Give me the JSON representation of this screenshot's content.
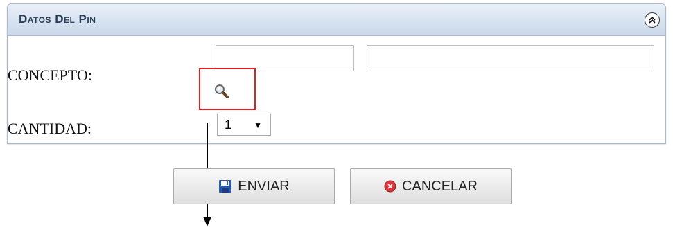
{
  "panel": {
    "title": "Datos Del Pin"
  },
  "form": {
    "concepto_label": "CONCEPTO:",
    "cantidad_label": "CANTIDAD:",
    "concepto_code_value": "",
    "concepto_desc_value": "",
    "cantidad_selected": "1"
  },
  "icons": {
    "collapse": "chevron-double-up-icon",
    "search": "magnifier-icon",
    "save": "floppy-disk-icon",
    "cancel": "cancel-circle-icon"
  },
  "buttons": {
    "enviar_label": "ENVIAR",
    "cancelar_label": "CANCELAR"
  },
  "colors": {
    "highlight": "#e02020",
    "header_bg": "#c9d8ea"
  }
}
